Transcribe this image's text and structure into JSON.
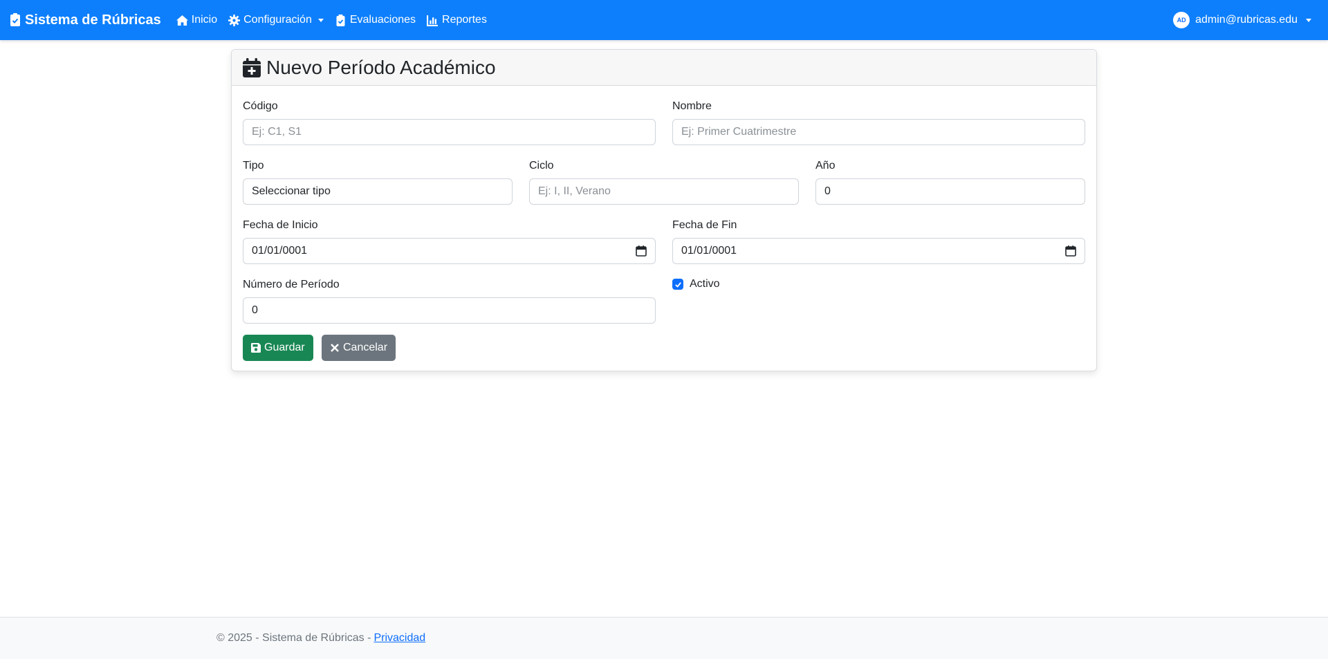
{
  "navbar": {
    "brand": "Sistema de Rúbricas",
    "items": [
      {
        "label": "Inicio",
        "icon": "home-icon"
      },
      {
        "label": "Configuración",
        "icon": "gear-icon",
        "dropdown": true
      },
      {
        "label": "Evaluaciones",
        "icon": "clipboard-check-icon"
      },
      {
        "label": "Reportes",
        "icon": "chart-bar-icon"
      }
    ],
    "user": {
      "initials": "AD",
      "email": "admin@rubricas.edu"
    }
  },
  "form": {
    "title": "Nuevo Período Académico",
    "codigo": {
      "label": "Código",
      "placeholder": "Ej: C1, S1",
      "value": ""
    },
    "nombre": {
      "label": "Nombre",
      "placeholder": "Ej: Primer Cuatrimestre",
      "value": ""
    },
    "tipo": {
      "label": "Tipo",
      "value": "Seleccionar tipo"
    },
    "ciclo": {
      "label": "Ciclo",
      "placeholder": "Ej: I, II, Verano",
      "value": ""
    },
    "anio": {
      "label": "Año",
      "value": "0"
    },
    "fecha_inicio": {
      "label": "Fecha de Inicio",
      "value": "01/01/0001"
    },
    "fecha_fin": {
      "label": "Fecha de Fin",
      "value": "01/01/0001"
    },
    "numero_periodo": {
      "label": "Número de Período",
      "value": "0"
    },
    "activo": {
      "label": "Activo",
      "checked": true
    },
    "buttons": {
      "save": "Guardar",
      "cancel": "Cancelar"
    }
  },
  "footer": {
    "text": "© 2025 - Sistema de Rúbricas -",
    "link": "Privacidad"
  },
  "colors": {
    "navbar": "#0d7ffd",
    "save": "#198754",
    "cancel": "#6c757d",
    "checkbox": "#0d6efd"
  }
}
